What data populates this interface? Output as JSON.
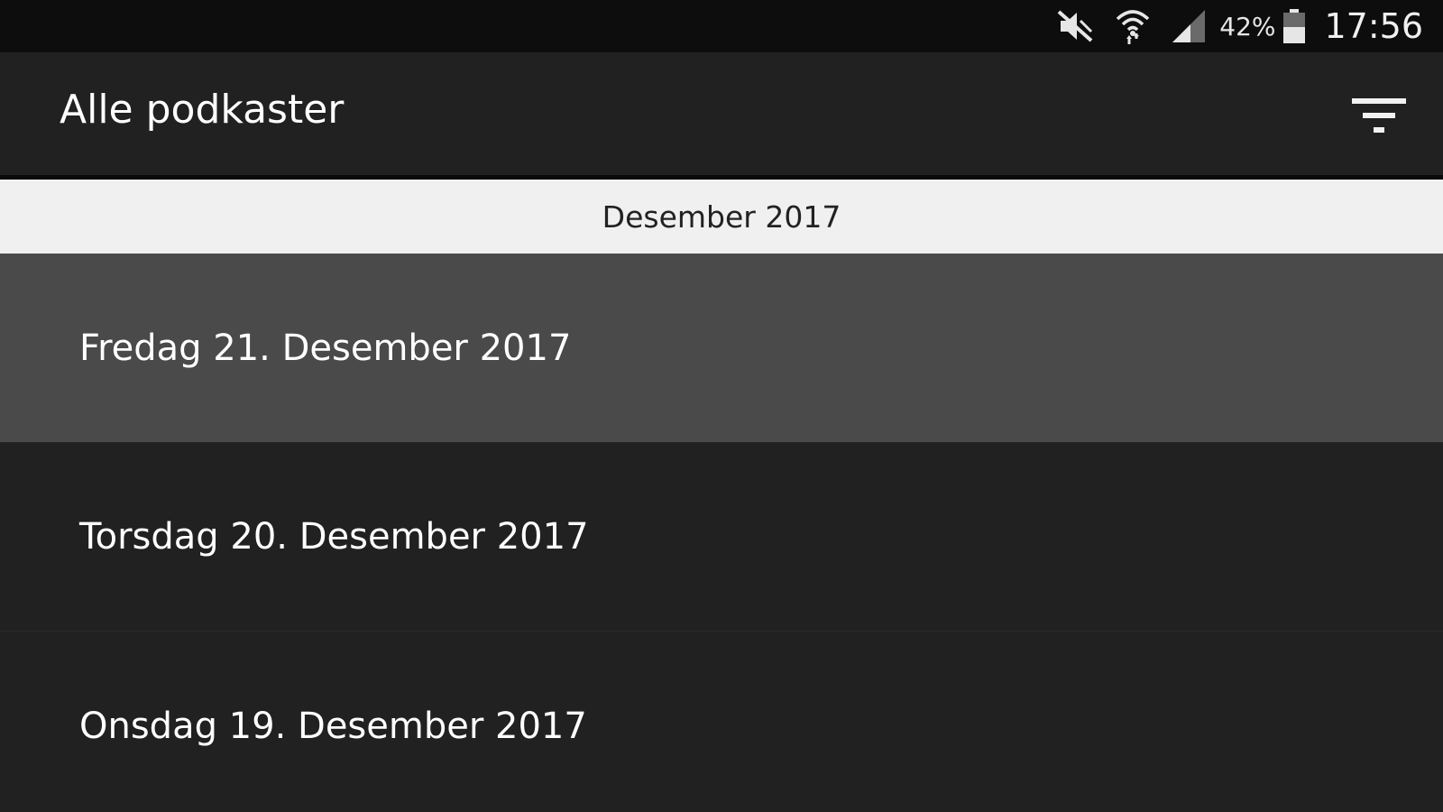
{
  "status_bar": {
    "icons": [
      "mute-icon",
      "wifi-icon",
      "signal-icon"
    ],
    "battery_percent": "42%",
    "time": "17:56"
  },
  "app_bar": {
    "title": "Alle podkaster",
    "filter_icon": "filter-icon"
  },
  "list": {
    "section_header": "Desember 2017",
    "items": [
      {
        "label": "Fredag 21. Desember 2017",
        "selected": true
      },
      {
        "label": "Torsdag 20. Desember 2017",
        "selected": false
      },
      {
        "label": "Onsdag 19. Desember 2017",
        "selected": false
      }
    ]
  },
  "colors": {
    "status_bar_bg": "#0d0d0d",
    "app_bg": "#212121",
    "header_bg": "#f0f0f0",
    "selected_bg": "#4a4a4a",
    "text": "#ffffff"
  }
}
